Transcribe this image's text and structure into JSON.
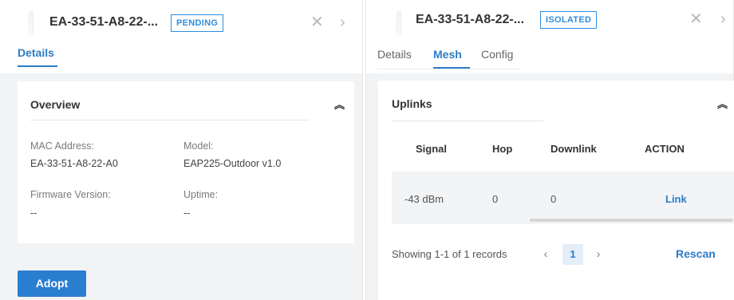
{
  "left": {
    "device_name": "EA-33-51-A8-22-...",
    "status": "PENDING",
    "tabs": [
      {
        "label": "Details"
      }
    ],
    "overview": {
      "title": "Overview",
      "fields": [
        {
          "label": "MAC Address:",
          "value": "EA-33-51-A8-22-A0"
        },
        {
          "label": "Model:",
          "value": "EAP225-Outdoor v1.0"
        },
        {
          "label": "Firmware Version:",
          "value": "--"
        },
        {
          "label": "Uptime:",
          "value": "--"
        }
      ]
    },
    "adopt_label": "Adopt"
  },
  "right": {
    "device_name": "EA-33-51-A8-22-...",
    "status": "ISOLATED",
    "tabs": [
      {
        "label": "Details"
      },
      {
        "label": "Mesh"
      },
      {
        "label": "Config"
      }
    ],
    "active_tab": "Mesh",
    "uplinks": {
      "title": "Uplinks",
      "columns": [
        "Signal",
        "Hop",
        "Downlink",
        "ACTION"
      ],
      "rows": [
        {
          "signal": "-43 dBm",
          "hop": "0",
          "downlink": "0",
          "action": "Link"
        }
      ],
      "records_text": "Showing 1-1 of 1 records",
      "current_page": "1",
      "rescan_label": "Rescan"
    }
  },
  "icons": {
    "close": "close-icon",
    "next": "chevron-right-icon",
    "collapse": "double-chevron-up-icon",
    "prev_page": "chevron-left-icon",
    "next_page": "chevron-right-icon"
  },
  "colors": {
    "accent": "#2d7bc9",
    "badge": "#2d8ee0",
    "button": "#2a7ed0",
    "background": "#f2f3f5"
  }
}
